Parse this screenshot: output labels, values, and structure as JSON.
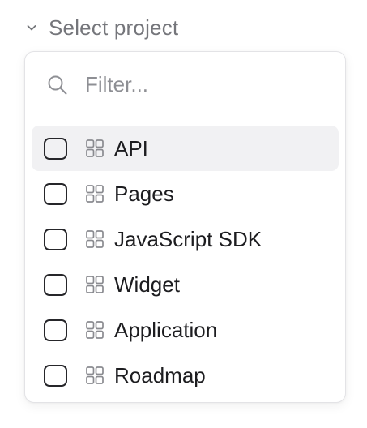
{
  "trigger": {
    "label": "Select project",
    "icon": "chevron-down-icon"
  },
  "filter": {
    "placeholder": "Filter...",
    "value": "",
    "icon": "search-icon"
  },
  "projects": [
    {
      "label": "API",
      "checked": false,
      "highlighted": true,
      "icon": "grid-icon"
    },
    {
      "label": "Pages",
      "checked": false,
      "highlighted": false,
      "icon": "grid-icon"
    },
    {
      "label": "JavaScript SDK",
      "checked": false,
      "highlighted": false,
      "icon": "grid-icon"
    },
    {
      "label": "Widget",
      "checked": false,
      "highlighted": false,
      "icon": "grid-icon"
    },
    {
      "label": "Application",
      "checked": false,
      "highlighted": false,
      "icon": "grid-icon"
    },
    {
      "label": "Roadmap",
      "checked": false,
      "highlighted": false,
      "icon": "grid-icon"
    }
  ],
  "colors": {
    "highlight": "#f1f1f3",
    "border": "#e3e3e6",
    "text": "#1d1d20",
    "muted": "#75767b"
  }
}
